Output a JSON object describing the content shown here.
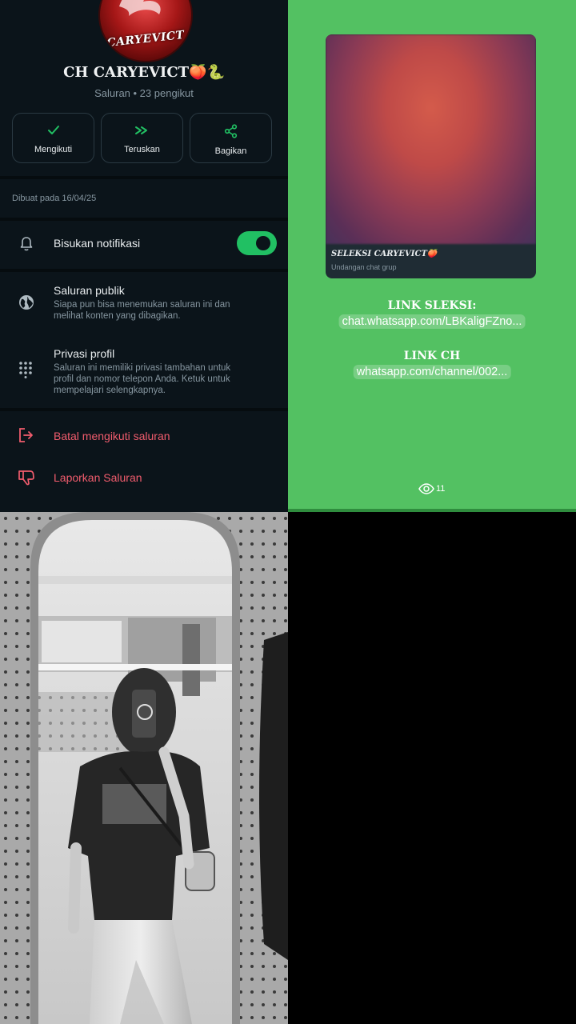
{
  "channel": {
    "avatar_text": "CARYEVICT",
    "title": "CH CARYEVICT🍑🐍",
    "subtitle": "Saluran • 23 pengikut",
    "actions": [
      {
        "label": "Mengikuti",
        "icon": "check-icon"
      },
      {
        "label": "Teruskan",
        "icon": "forward-icon"
      },
      {
        "label": "Bagikan",
        "icon": "share-icon"
      }
    ],
    "created": "Dibuat pada 16/04/25",
    "mute": {
      "label": "Bisukan notifikasi",
      "enabled": true
    },
    "public": {
      "label": "Saluran publik",
      "desc": "Siapa pun bisa menemukan saluran ini dan melihat konten yang dibagikan."
    },
    "privacy": {
      "label": "Privasi profil",
      "desc": "Saluran ini memiliki privasi tambahan untuk profil dan nomor telepon Anda. Ketuk untuk mempelajari selengkapnya."
    },
    "unfollow": "Batal mengikuti saluran",
    "report": "Laporkan Saluran",
    "accent": "#21c063",
    "danger": "#f15c6d"
  },
  "message": {
    "card_title": "SELEKSI CARYEVICT🍑",
    "card_subtitle": "Undangan chat grup",
    "link1_heading": "LINK SLEKSI:",
    "link1": "chat.whatsapp.com/LBKaligFZno...",
    "link2_heading": "LINK CH",
    "link2": "whatsapp.com/channel/002...",
    "views": "11",
    "background": "#53c162"
  }
}
